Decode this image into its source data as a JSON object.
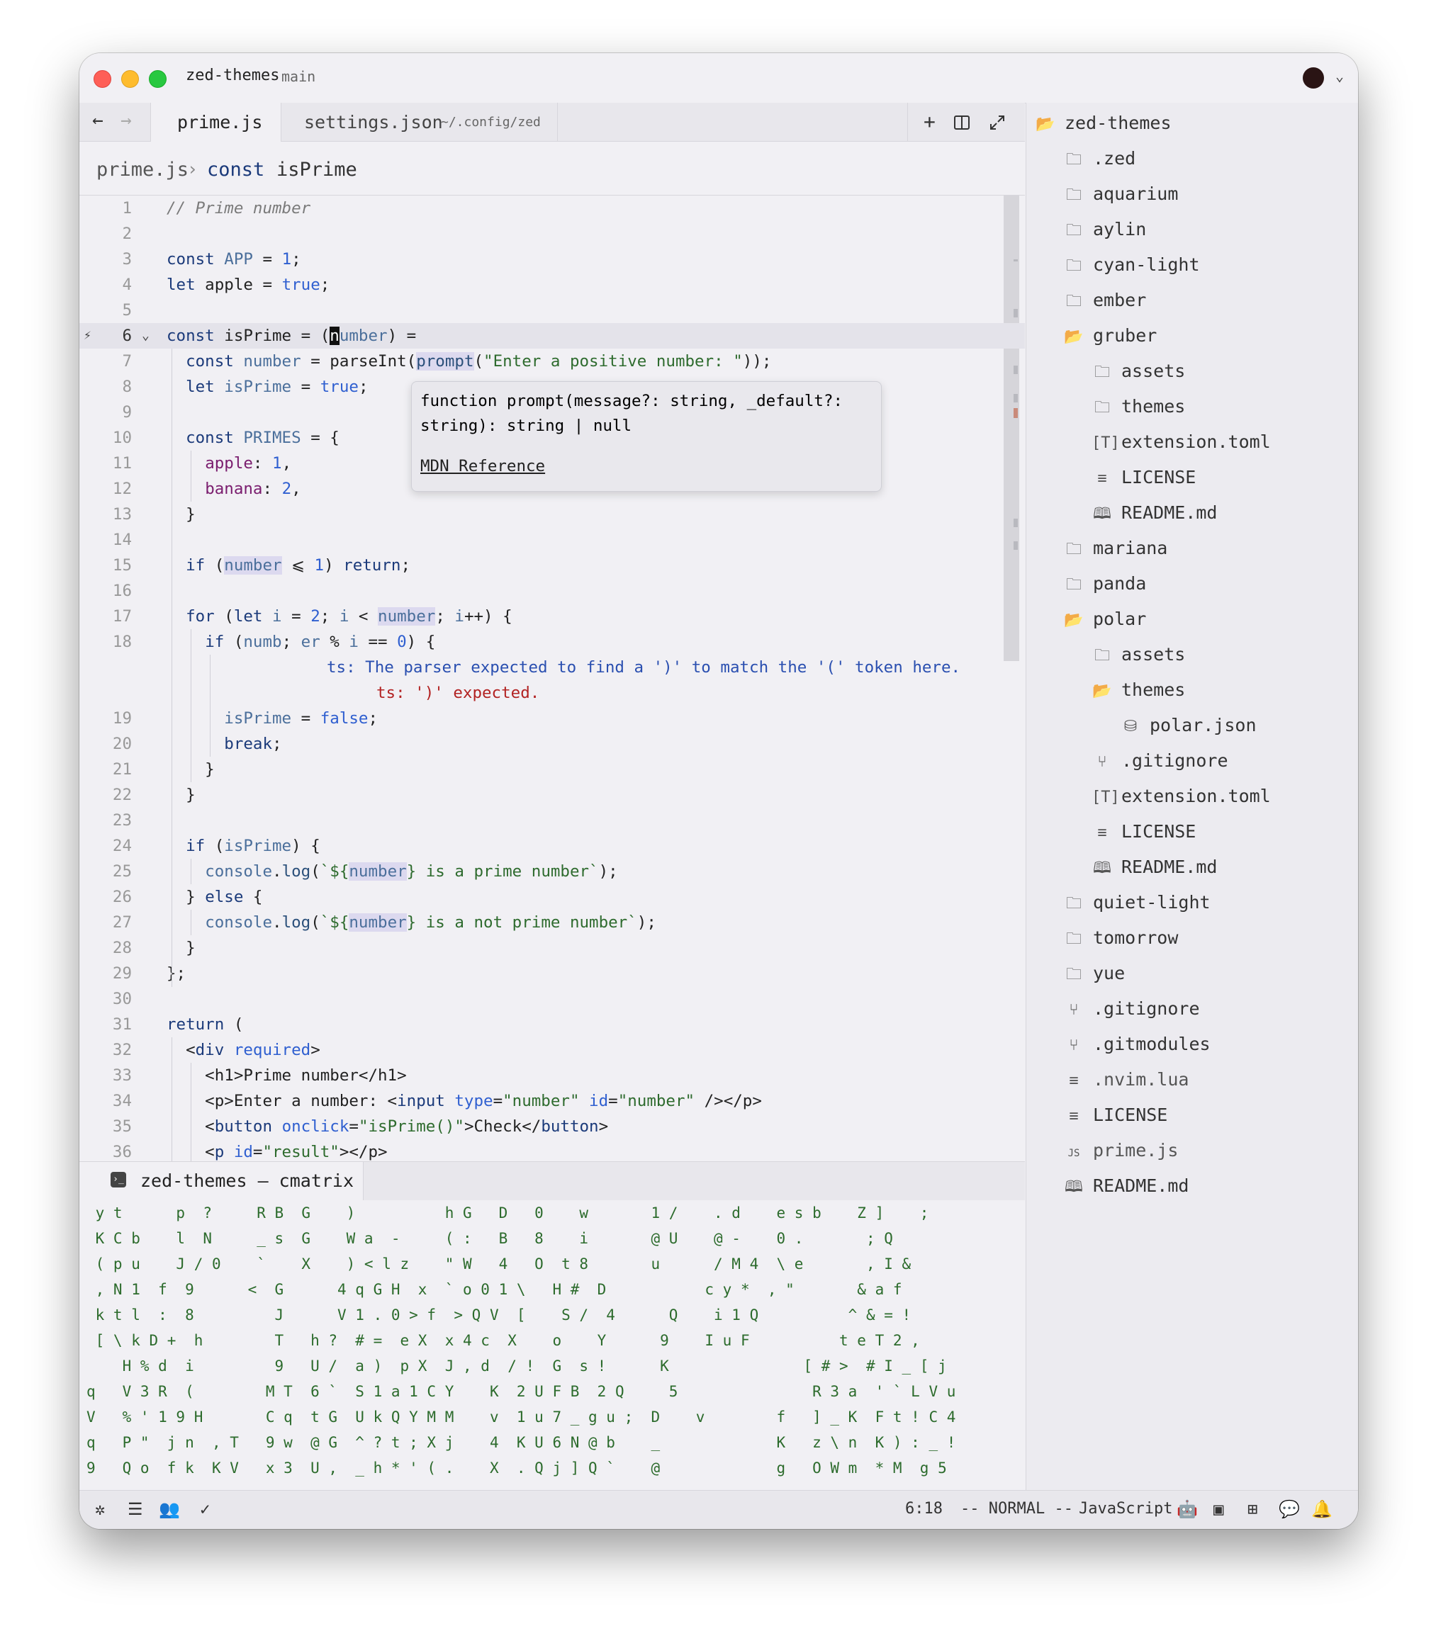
{
  "titlebar": {
    "project": "zed-themes",
    "branch": "main"
  },
  "tabs": [
    {
      "label": "prime.js",
      "active": true
    },
    {
      "label": "settings.json",
      "path": "~/.config/zed"
    }
  ],
  "breadcrumb": {
    "file": "prime.js",
    "separator": "›",
    "keyword": "const",
    "symbol": "isPrime"
  },
  "editor": {
    "line_numbers": [
      "1",
      "2",
      "3",
      "4",
      "5",
      "6",
      "7",
      "8",
      "9",
      "10",
      "11",
      "12",
      "13",
      "14",
      "15",
      "16",
      "17",
      "18",
      "19",
      "20",
      "21",
      "22",
      "23",
      "24",
      "25",
      "26",
      "27",
      "28",
      "29",
      "30",
      "31",
      "32",
      "33",
      "34",
      "35",
      "36"
    ],
    "line1_comment": "// Prime number",
    "diagnostic_main": "ts: The parser expected to find a ')' to match the '(' token here.",
    "diagnostic_sub": "ts: ')' expected."
  },
  "hover": {
    "line1": "function prompt(message?: string, _default?:",
    "line2": "string): string | null",
    "link": "MDN Reference"
  },
  "terminal": {
    "tab_label": "zed-themes — cmatrix",
    "rows": [
      " y t      p  ?     R B  G    )          h G   D   0    w       1 /    . d    e s b    Z ]    ;",
      " K C b    l  N     _ s  G    W a  -     ( :   B   8    i       @ U    @ -    0 .       ; Q",
      " ( p u    J / 0    `    X    ) < l z    \" W   4   O  t 8       u      / M 4  \\ e       , I &",
      " , N 1  f  9      <  G      4 q G H  x  ` o 0 1 \\   H #  D           c y *  , \"       & a f",
      " k t l  :  8         J      V 1 . 0 > f  > Q V  [    S /  4      Q    i 1 Q          ^ & = !",
      " [ \\ k D +  h        T   h ?  # =  e X  x 4 c  X    o    Y      9    I u F          t e T 2 ,",
      "    H % d  i         9   U /  a )  p X  J , d  / !  G  s !      K               [ # >  # I _ [ j",
      "q   V 3 R  (        M T  6 `  S 1 a 1 C Y    K  2 U F B  2 Q     5               R 3 a  ' ` L V u",
      "V   % ' 1 9 H       C q  t G  U k Q Y M M    v  1 u 7 _ g u ;  D    v        f   ] _ K  F t ! C 4",
      "q   P \"  j n  , T   9 w  @ G  ^ ? t ; X j    4  K U 6 N @ b    _             K   z \\ n  K ) : _ !",
      "9   Q o  f k  K V   x 3  U ,  _ h * ' ( .    X  . Q j ] Q `    @             g   O W m  * M  g 5"
    ]
  },
  "project": {
    "items": [
      {
        "name": "zed-themes",
        "icon": "folder-open-icon"
      },
      {
        "name": ".zed",
        "icon": "folder-icon"
      },
      {
        "name": "aquarium",
        "icon": "folder-icon"
      },
      {
        "name": "aylin",
        "icon": "folder-icon"
      },
      {
        "name": "cyan-light",
        "icon": "folder-icon"
      },
      {
        "name": "ember",
        "icon": "folder-icon"
      },
      {
        "name": "gruber",
        "icon": "folder-open-icon"
      },
      {
        "name": "assets",
        "icon": "folder-icon"
      },
      {
        "name": "themes",
        "icon": "folder-icon"
      },
      {
        "name": "extension.toml",
        "icon": "toml-icon"
      },
      {
        "name": "LICENSE",
        "icon": "text-icon"
      },
      {
        "name": "README.md",
        "icon": "book-icon"
      },
      {
        "name": "mariana",
        "icon": "folder-icon"
      },
      {
        "name": "panda",
        "icon": "folder-icon"
      },
      {
        "name": "polar",
        "icon": "folder-open-icon"
      },
      {
        "name": "assets",
        "icon": "folder-icon"
      },
      {
        "name": "themes",
        "icon": "folder-open-icon"
      },
      {
        "name": "polar.json",
        "icon": "database-icon"
      },
      {
        "name": ".gitignore",
        "icon": "git-icon"
      },
      {
        "name": "extension.toml",
        "icon": "toml-icon"
      },
      {
        "name": "LICENSE",
        "icon": "text-icon"
      },
      {
        "name": "README.md",
        "icon": "book-icon"
      },
      {
        "name": "quiet-light",
        "icon": "folder-icon"
      },
      {
        "name": "tomorrow",
        "icon": "folder-icon"
      },
      {
        "name": "yue",
        "icon": "folder-icon"
      },
      {
        "name": ".gitignore",
        "icon": "git-icon"
      },
      {
        "name": ".gitmodules",
        "icon": "git-icon"
      },
      {
        "name": ".nvim.lua",
        "icon": "text-icon"
      },
      {
        "name": "LICENSE",
        "icon": "text-icon"
      },
      {
        "name": "prime.js",
        "icon": "js-icon"
      },
      {
        "name": "README.md",
        "icon": "book-icon"
      }
    ]
  },
  "statusbar": {
    "position": "6:18",
    "mode": "-- NORMAL --",
    "language": "JavaScript"
  }
}
